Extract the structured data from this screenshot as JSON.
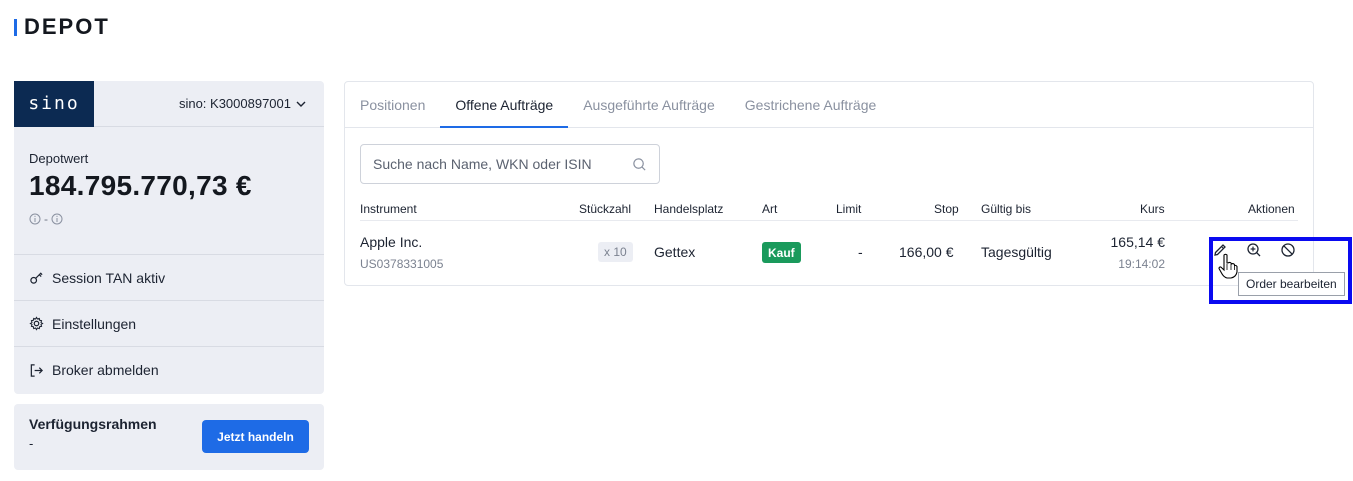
{
  "header": {
    "title": "DEPOT"
  },
  "account": {
    "logo_text": "sino",
    "selector_label": "sino: K3000897001",
    "depot_label": "Depotwert",
    "depot_value": "184.795.770,73 €",
    "depot_change": "-"
  },
  "menu": [
    {
      "label": "Session TAN aktiv",
      "icon": "key-icon"
    },
    {
      "label": "Einstellungen",
      "icon": "gear-icon"
    },
    {
      "label": "Broker abmelden",
      "icon": "logout-icon"
    }
  ],
  "rahmen": {
    "label": "Verfügungsrahmen",
    "value": "-",
    "button_label": "Jetzt handeln"
  },
  "tabs": [
    {
      "label": "Positionen",
      "active": false
    },
    {
      "label": "Offene Aufträge",
      "active": true
    },
    {
      "label": "Ausgeführte Aufträge",
      "active": false
    },
    {
      "label": "Gestrichene Aufträge",
      "active": false
    }
  ],
  "search": {
    "placeholder": "Suche nach Name, WKN oder ISIN"
  },
  "table": {
    "columns": [
      "Instrument",
      "Stückzahl",
      "Handelsplatz",
      "Art",
      "Limit",
      "Stop",
      "Gültig bis",
      "Kurs",
      "Aktionen"
    ],
    "rows": [
      {
        "name": "Apple Inc.",
        "isin": "US0378331005",
        "quantity": "x 10",
        "venue": "Gettex",
        "type": "Kauf",
        "limit": "-",
        "stop": "166,00 €",
        "valid_until": "Tagesgültig",
        "price": "165,14 €",
        "time": "19:14:02"
      }
    ]
  },
  "actions": {
    "tooltip": "Order bearbeiten",
    "icons": [
      "pencil-icon",
      "zoom-in-icon",
      "cancel-icon"
    ]
  },
  "colors": {
    "accent": "#1e6be6",
    "logo_bg": "#0c2a52",
    "buy_badge": "#1a9a5c",
    "highlight": "#0a0af0"
  }
}
